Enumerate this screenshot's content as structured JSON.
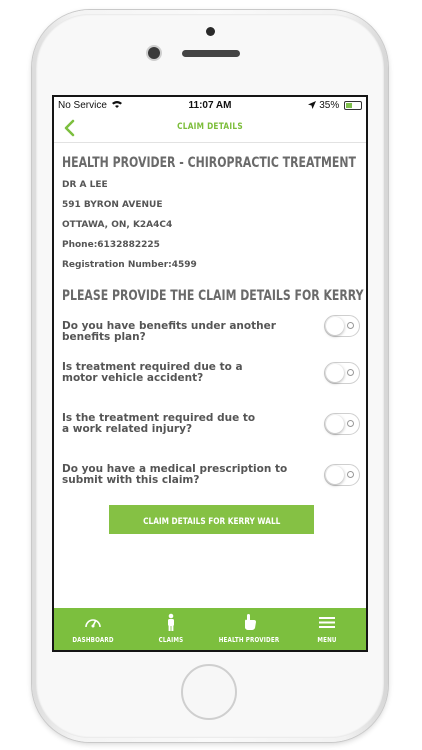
{
  "status_bar": {
    "carrier": "No Service",
    "time": "11:07 AM",
    "battery": "35%"
  },
  "nav": {
    "title": "CLAIM DETAILS"
  },
  "provider": {
    "heading": "HEALTH PROVIDER - CHIROPRACTIC TREATMENT",
    "name": "DR A LEE",
    "address1": "591 BYRON AVENUE",
    "address2": "OTTAWA, ON, K2A4C4",
    "phone": "Phone:6132882225",
    "registration": "Registration Number:4599"
  },
  "claim": {
    "heading": "PLEASE PROVIDE THE CLAIM DETAILS FOR KERRY WALL",
    "questions": [
      {
        "text": "Do you have benefits under another benefits plan?",
        "on": false
      },
      {
        "text": "Is treatment required due to a motor vehicle accident?",
        "on": false
      },
      {
        "text": "Is the treatment required due to a work related injury?",
        "on": false
      },
      {
        "text": "Do you have a medical prescription to submit with this claim?",
        "on": false
      }
    ],
    "button_label": "CLAIM DETAILS FOR  KERRY WALL"
  },
  "tabs": [
    {
      "label": "DASHBOARD",
      "icon": "gauge-icon"
    },
    {
      "label": "CLAIMS",
      "icon": "person-icon"
    },
    {
      "label": "HEALTH PROVIDER",
      "icon": "hand-pointer-icon"
    },
    {
      "label": "MENU",
      "icon": "hamburger-menu-icon"
    }
  ],
  "colors": {
    "accent": "#7cbf3e",
    "heading_gray": "#6a6a6a"
  }
}
